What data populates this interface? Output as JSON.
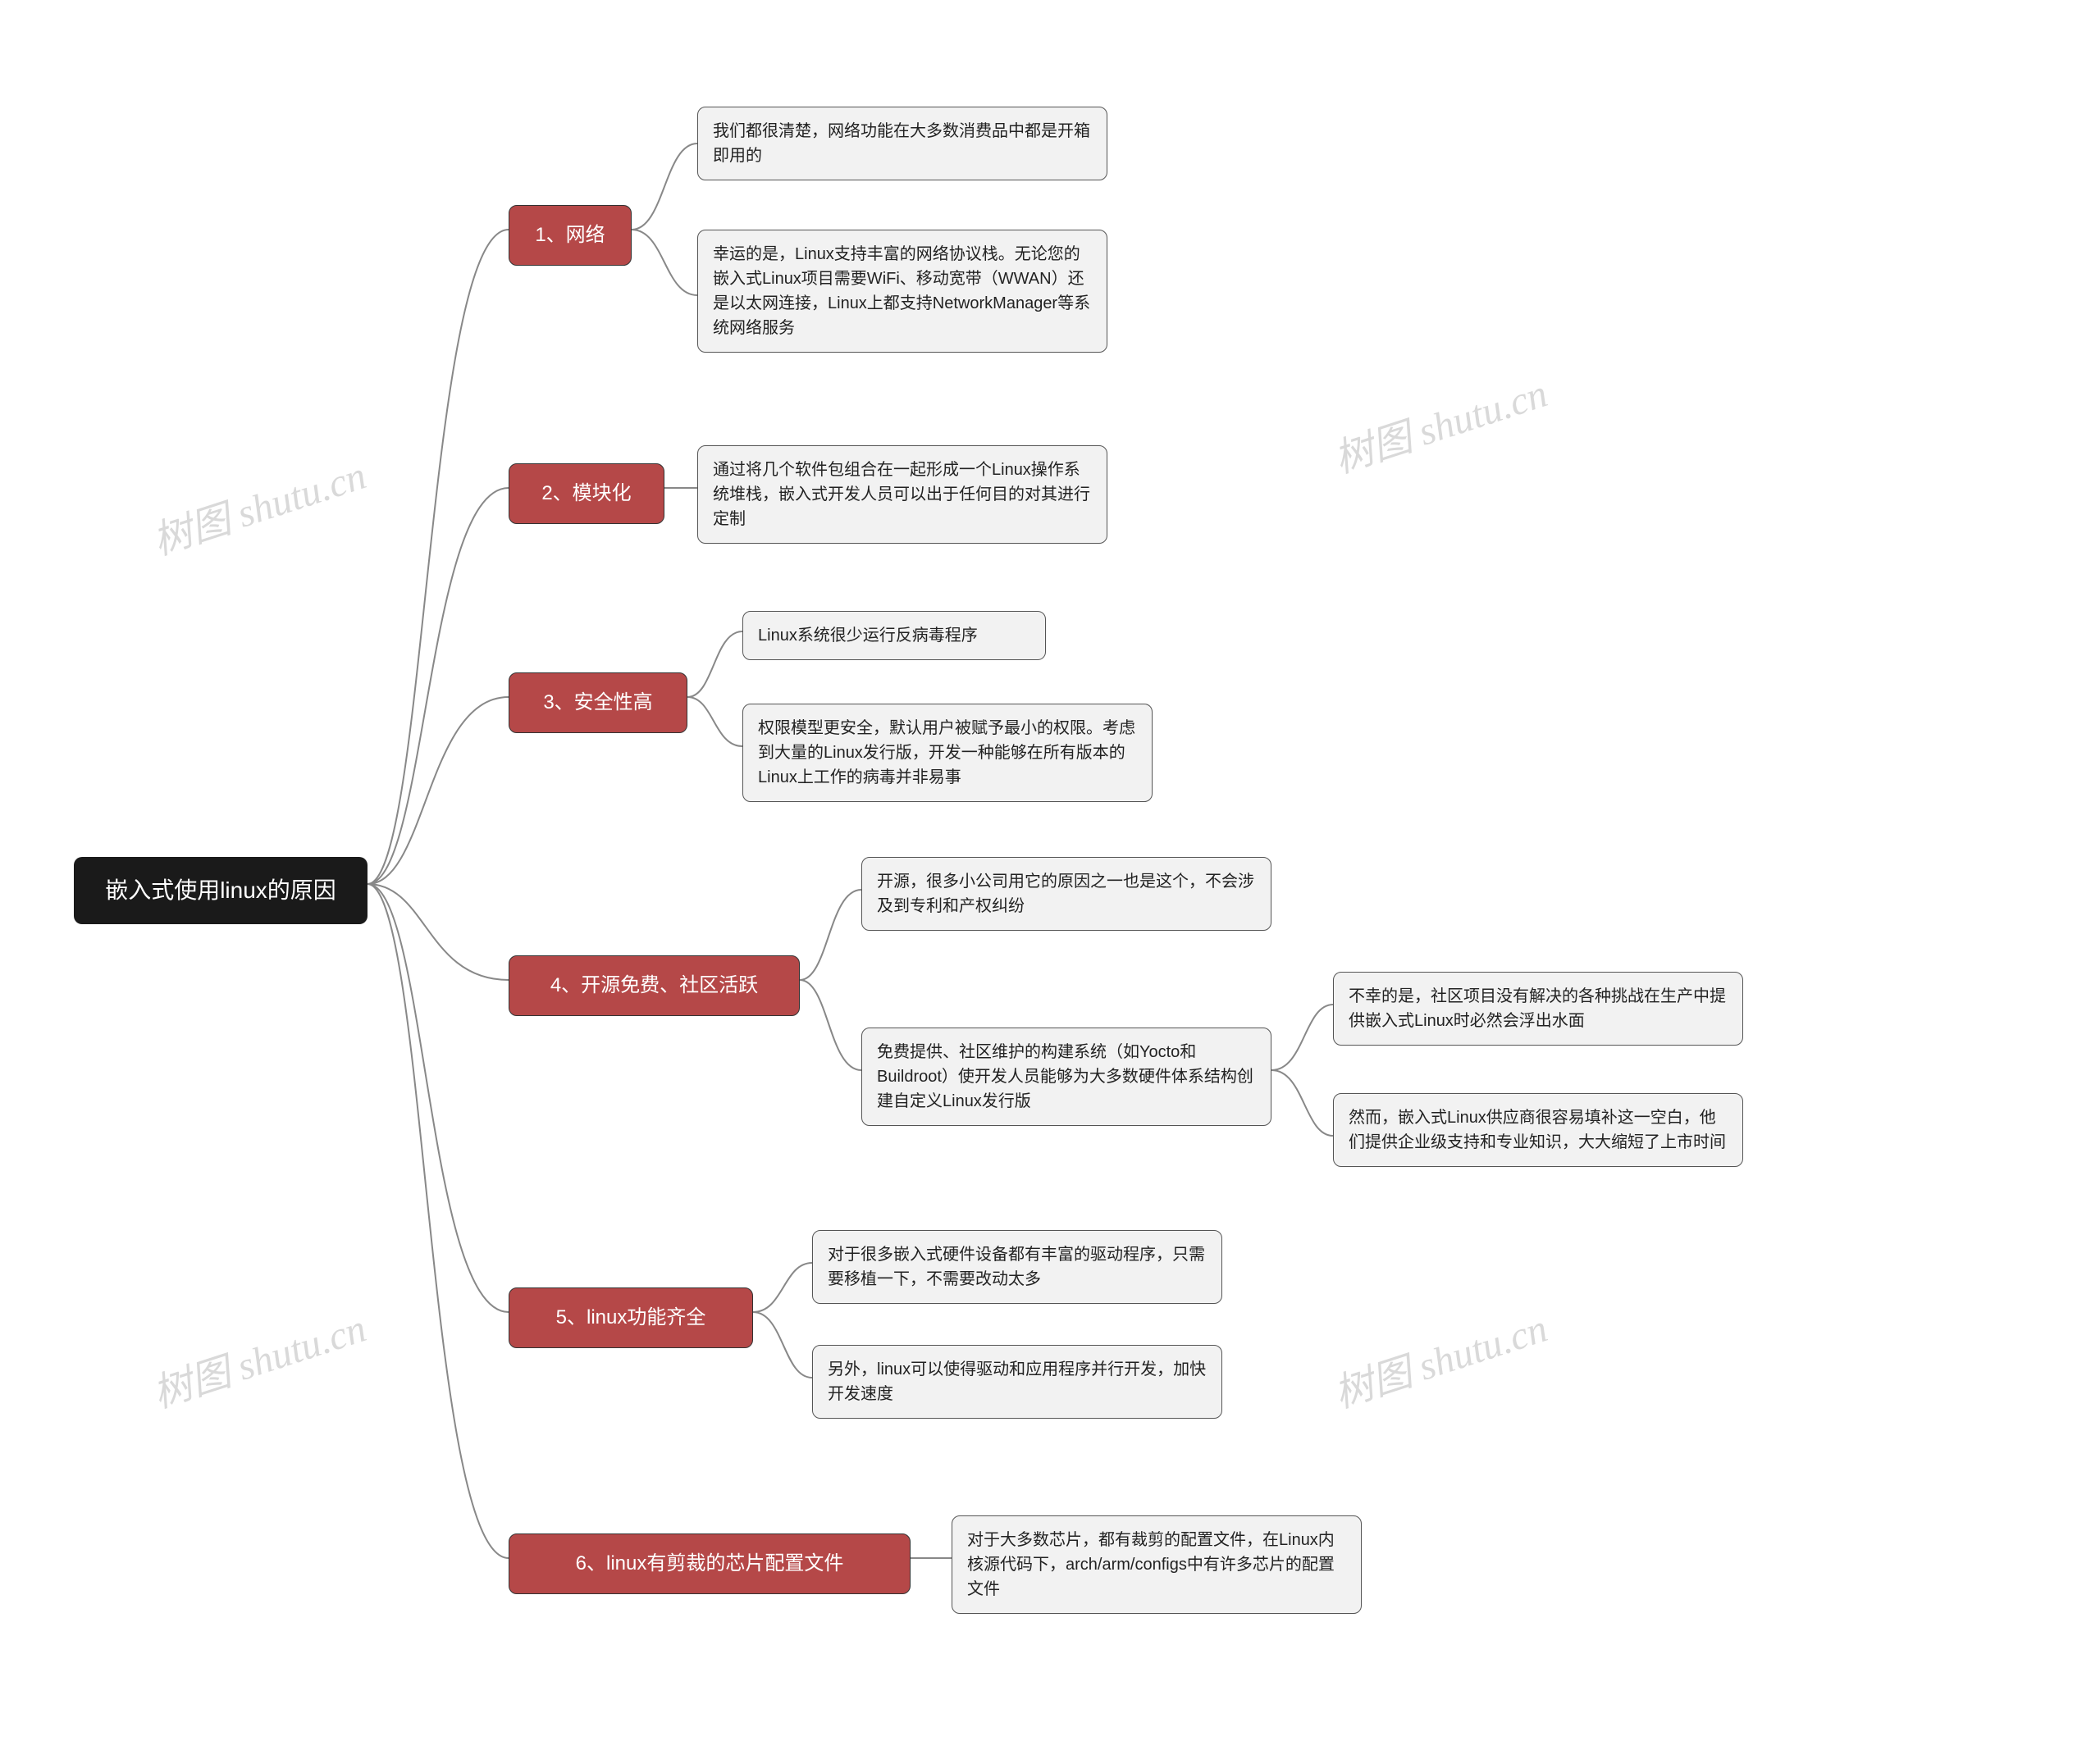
{
  "root": {
    "label": "嵌入式使用linux的原因"
  },
  "branches": [
    {
      "key": "b1",
      "label": "1、网络",
      "leaves": [
        {
          "key": "b1l1",
          "text": "我们都很清楚，网络功能在大多数消费品中都是开箱即用的"
        },
        {
          "key": "b1l2",
          "text": "幸运的是，Linux支持丰富的网络协议栈。无论您的嵌入式Linux项目需要WiFi、移动宽带（WWAN）还是以太网连接，Linux上都支持NetworkManager等系统网络服务"
        }
      ]
    },
    {
      "key": "b2",
      "label": "2、模块化",
      "leaves": [
        {
          "key": "b2l1",
          "text": "通过将几个软件包组合在一起形成一个Linux操作系统堆栈，嵌入式开发人员可以出于任何目的对其进行定制"
        }
      ]
    },
    {
      "key": "b3",
      "label": "3、安全性高",
      "leaves": [
        {
          "key": "b3l1",
          "text": "Linux系统很少运行反病毒程序"
        },
        {
          "key": "b3l2",
          "text": "权限模型更安全，默认用户被赋予最小的权限。考虑到大量的Linux发行版，开发一种能够在所有版本的Linux上工作的病毒并非易事"
        }
      ]
    },
    {
      "key": "b4",
      "label": "4、开源免费、社区活跃",
      "leaves": [
        {
          "key": "b4l1",
          "text": "开源，很多小公司用它的原因之一也是这个，不会涉及到专利和产权纠纷"
        },
        {
          "key": "b4l2",
          "text": "免费提供、社区维护的构建系统（如Yocto和Buildroot）使开发人员能够为大多数硬件体系结构创建自定义Linux发行版",
          "subleaves": [
            {
              "key": "b4l2a",
              "text": "不幸的是，社区项目没有解决的各种挑战在生产中提供嵌入式Linux时必然会浮出水面"
            },
            {
              "key": "b4l2b",
              "text": "然而，嵌入式Linux供应商很容易填补这一空白，他们提供企业级支持和专业知识，大大缩短了上市时间"
            }
          ]
        }
      ]
    },
    {
      "key": "b5",
      "label": "5、linux功能齐全",
      "leaves": [
        {
          "key": "b5l1",
          "text": "对于很多嵌入式硬件设备都有丰富的驱动程序，只需要移植一下，不需要改动太多"
        },
        {
          "key": "b5l2",
          "text": "另外，linux可以使得驱动和应用程序并行开发，加快开发速度"
        }
      ]
    },
    {
      "key": "b6",
      "label": "6、linux有剪裁的芯片配置文件",
      "leaves": [
        {
          "key": "b6l1",
          "text": "对于大多数芯片，都有裁剪的配置文件，在Linux内核源代码下，arch/arm/configs中有许多芯片的配置文件"
        }
      ]
    }
  ],
  "watermark": "树图 shutu.cn"
}
